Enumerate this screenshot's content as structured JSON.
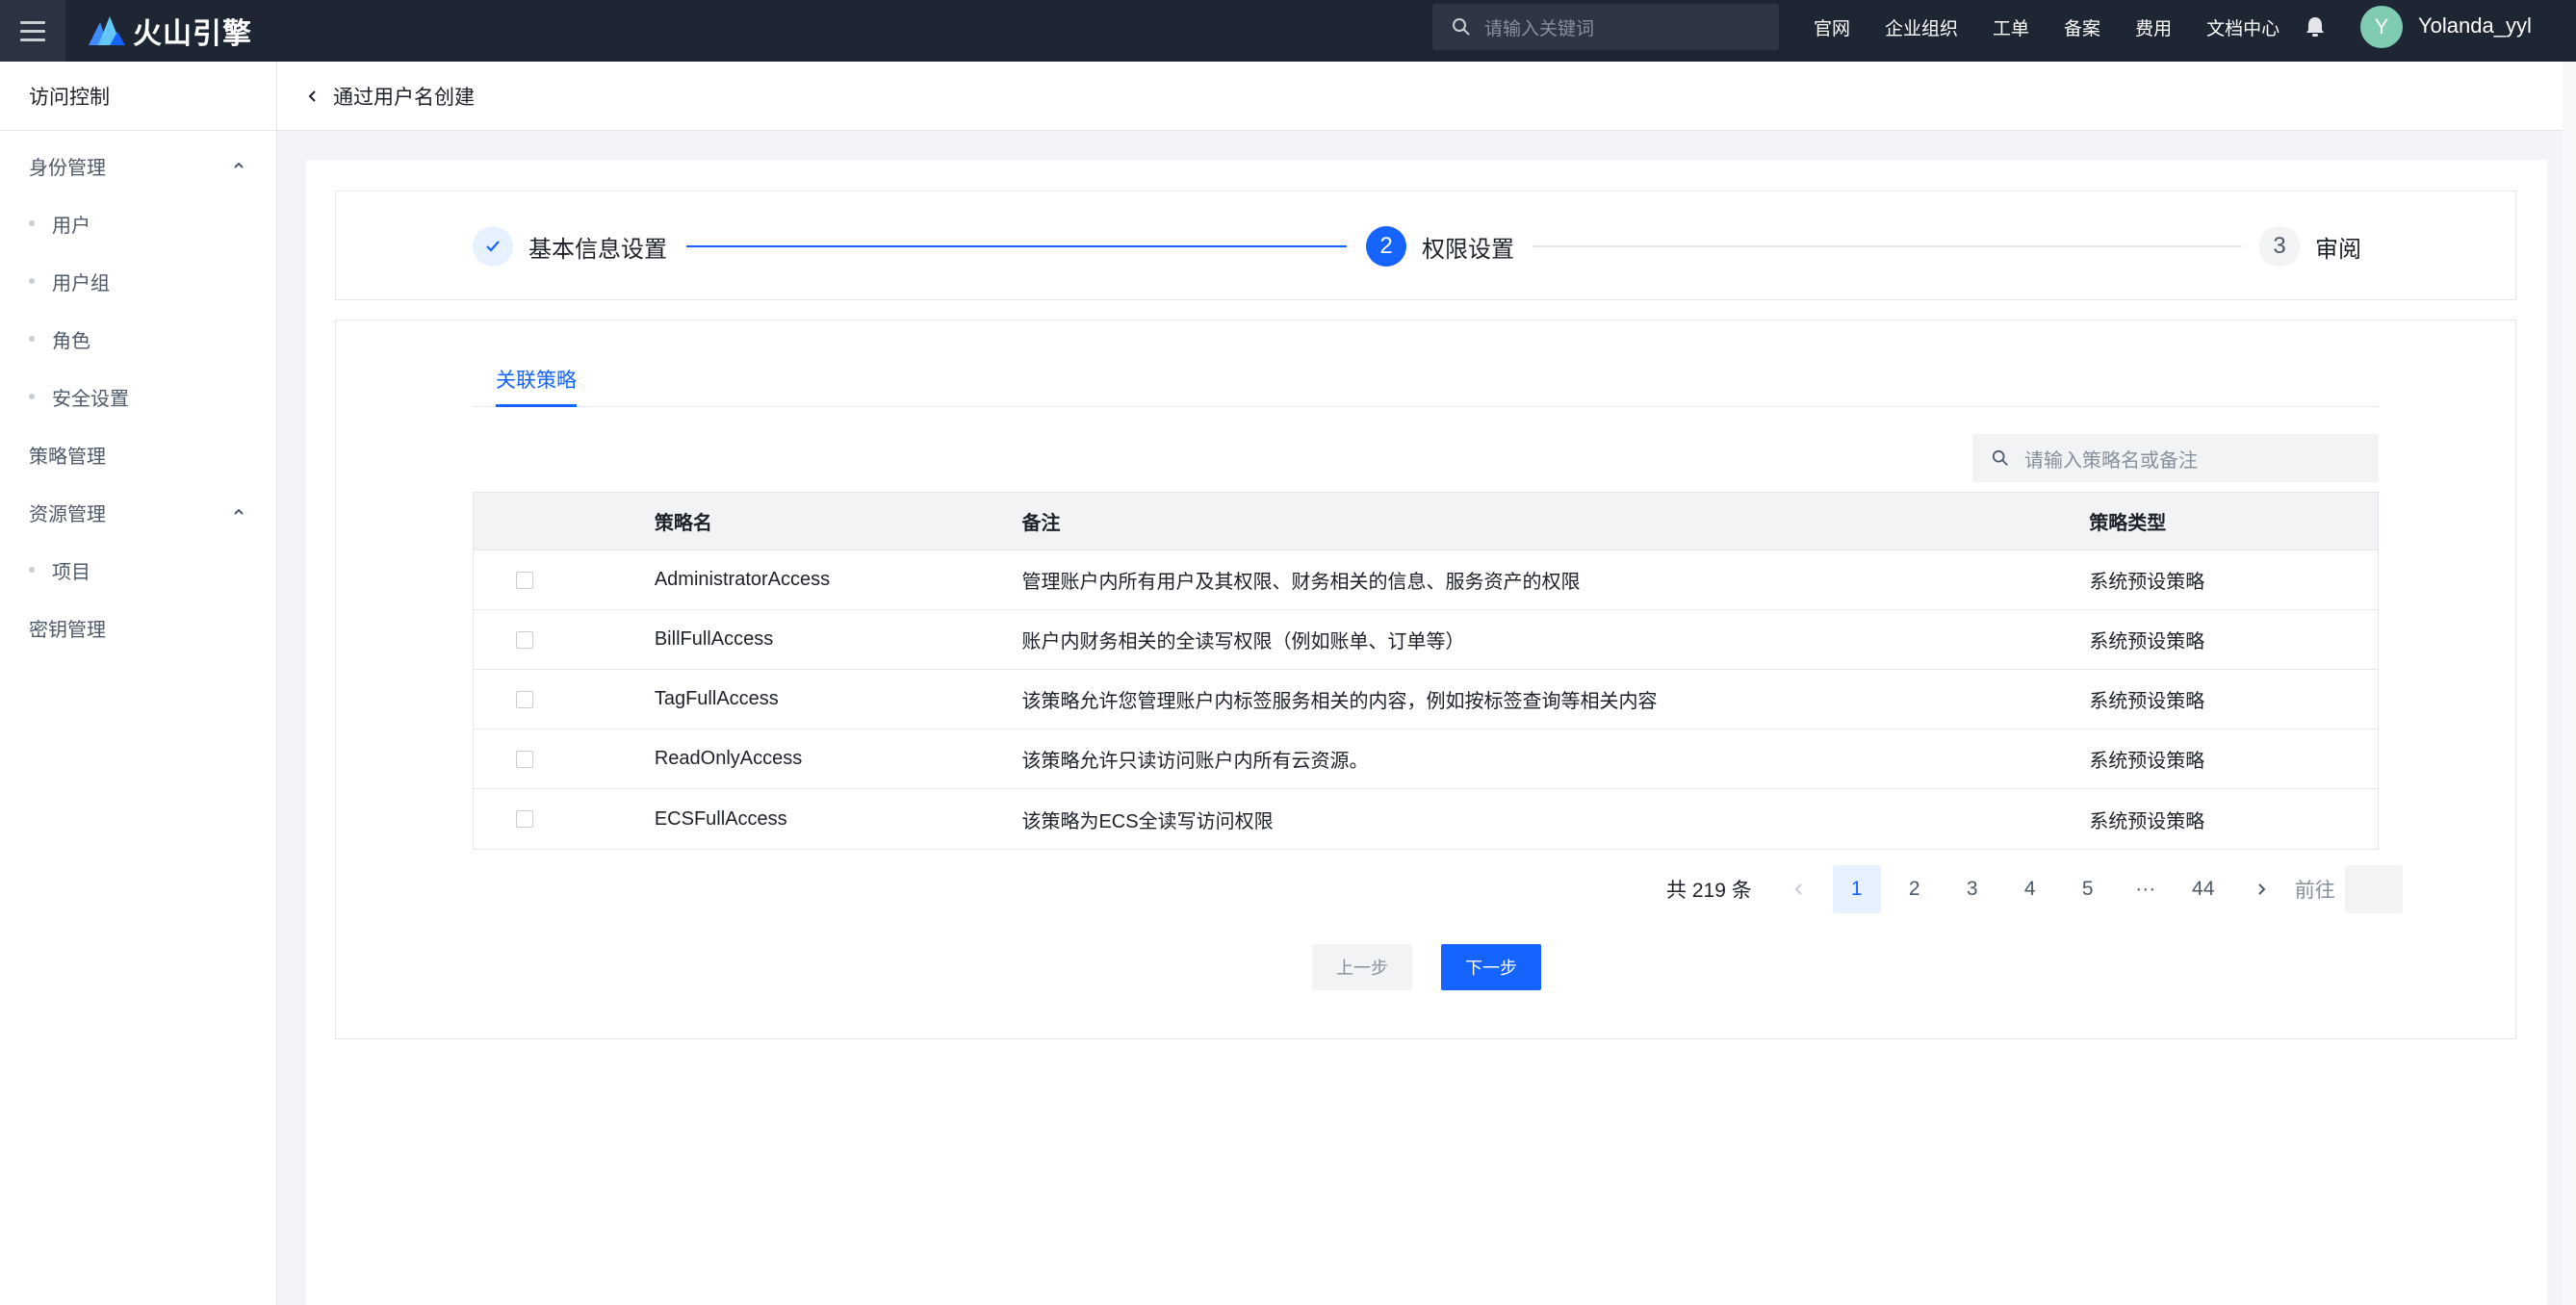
{
  "topbar": {
    "brand": "火山引擎",
    "search_placeholder": "请输入关键词",
    "nav": [
      "官网",
      "企业组织",
      "工单",
      "备案",
      "费用",
      "文档中心"
    ],
    "avatar_letter": "Y",
    "username": "Yolanda_yyl"
  },
  "sidebar": {
    "title": "访问控制",
    "groups": [
      {
        "label": "身份管理",
        "items": [
          "用户",
          "用户组",
          "角色",
          "安全设置"
        ]
      },
      {
        "label": "策略管理"
      },
      {
        "label": "资源管理",
        "items": [
          "项目"
        ]
      },
      {
        "label": "密钥管理"
      }
    ]
  },
  "page": {
    "title": "通过用户名创建"
  },
  "steps": [
    {
      "label": "基本信息设置",
      "state": "done"
    },
    {
      "number": "2",
      "label": "权限设置",
      "state": "active"
    },
    {
      "number": "3",
      "label": "审阅",
      "state": "wait"
    }
  ],
  "tab": "关联策略",
  "policy_search_placeholder": "请输入策略名或备注",
  "table": {
    "headers": [
      "策略名",
      "备注",
      "策略类型"
    ],
    "rows": [
      {
        "name": "AdministratorAccess",
        "note": "管理账户内所有用户及其权限、财务相关的信息、服务资产的权限",
        "type": "系统预设策略"
      },
      {
        "name": "BillFullAccess",
        "note": "账户内财务相关的全读写权限（例如账单、订单等）",
        "type": "系统预设策略"
      },
      {
        "name": "TagFullAccess",
        "note": "该策略允许您管理账户内标签服务相关的内容，例如按标签查询等相关内容",
        "type": "系统预设策略"
      },
      {
        "name": "ReadOnlyAccess",
        "note": "该策略允许只读访问账户内所有云资源。",
        "type": "系统预设策略"
      },
      {
        "name": "ECSFullAccess",
        "note": "该策略为ECS全读写访问权限",
        "type": "系统预设策略"
      }
    ]
  },
  "pagination": {
    "total": "共 219 条",
    "pages": [
      "1",
      "2",
      "3",
      "4",
      "5",
      "···",
      "44"
    ],
    "current": "1",
    "goto_label": "前往"
  },
  "buttons": {
    "prev": "上一步",
    "next": "下一步"
  },
  "colors": {
    "primary": "#1664ff",
    "topbar": "#1f2633"
  }
}
